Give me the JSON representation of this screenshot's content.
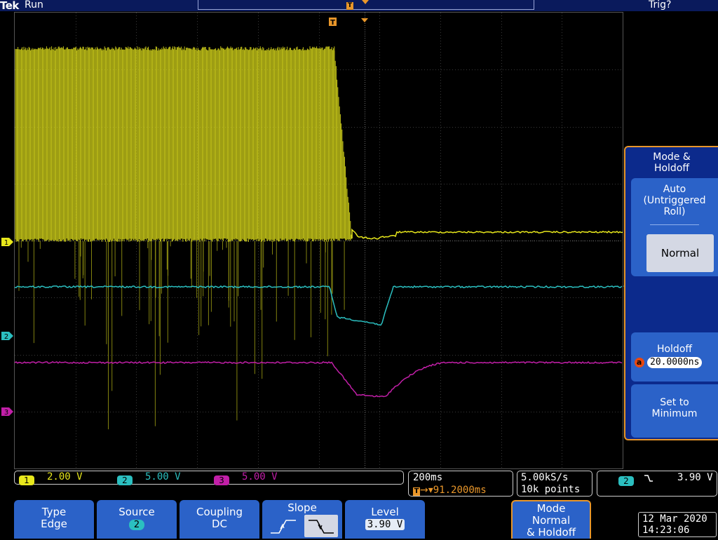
{
  "top_bar": {
    "brand": "Tek",
    "run_status": "Run",
    "trig_status": "Trig?",
    "trigger_marker": "T"
  },
  "channels": [
    {
      "id": "1",
      "color": "#e8e81c",
      "scale": "2.00 V"
    },
    {
      "id": "2",
      "color": "#2bbfc0",
      "scale": "5.00 V"
    },
    {
      "id": "3",
      "color": "#c21fa8",
      "scale": "5.00 V"
    }
  ],
  "timebase": {
    "scale": "200ms",
    "delay": "91.2000ms",
    "sample_rate": "5.00kS/s",
    "record_length": "10k points"
  },
  "trigger_readout": {
    "source": "2",
    "level": "3.90 V"
  },
  "side_menu": {
    "title": "Mode &\nHoldoff",
    "auto_label": "Auto\n(Untriggered\nRoll)",
    "normal_label": "Normal",
    "holdoff_label": "Holdoff",
    "holdoff_badge": "a",
    "holdoff_value": "20.0000ns",
    "set_min_label": "Set to\nMinimum"
  },
  "bottom_menu": {
    "type_label": "Type",
    "type_value": "Edge",
    "source_label": "Source",
    "source_value": "2",
    "coupling_label": "Coupling",
    "coupling_value": "DC",
    "slope_label": "Slope",
    "level_label": "Level",
    "level_value": "3.90 V",
    "mode_label": "Mode",
    "mode_value": "Normal",
    "mode_sub": "& Holdoff"
  },
  "datetime": {
    "date": "12 Mar 2020",
    "time": "14:23:06"
  },
  "colors": {
    "accent": "#e8962a",
    "menu_bg": "#2b62c8",
    "ch1": "#e8e81c",
    "ch2": "#2bbfc0",
    "ch3": "#c21fa8"
  }
}
